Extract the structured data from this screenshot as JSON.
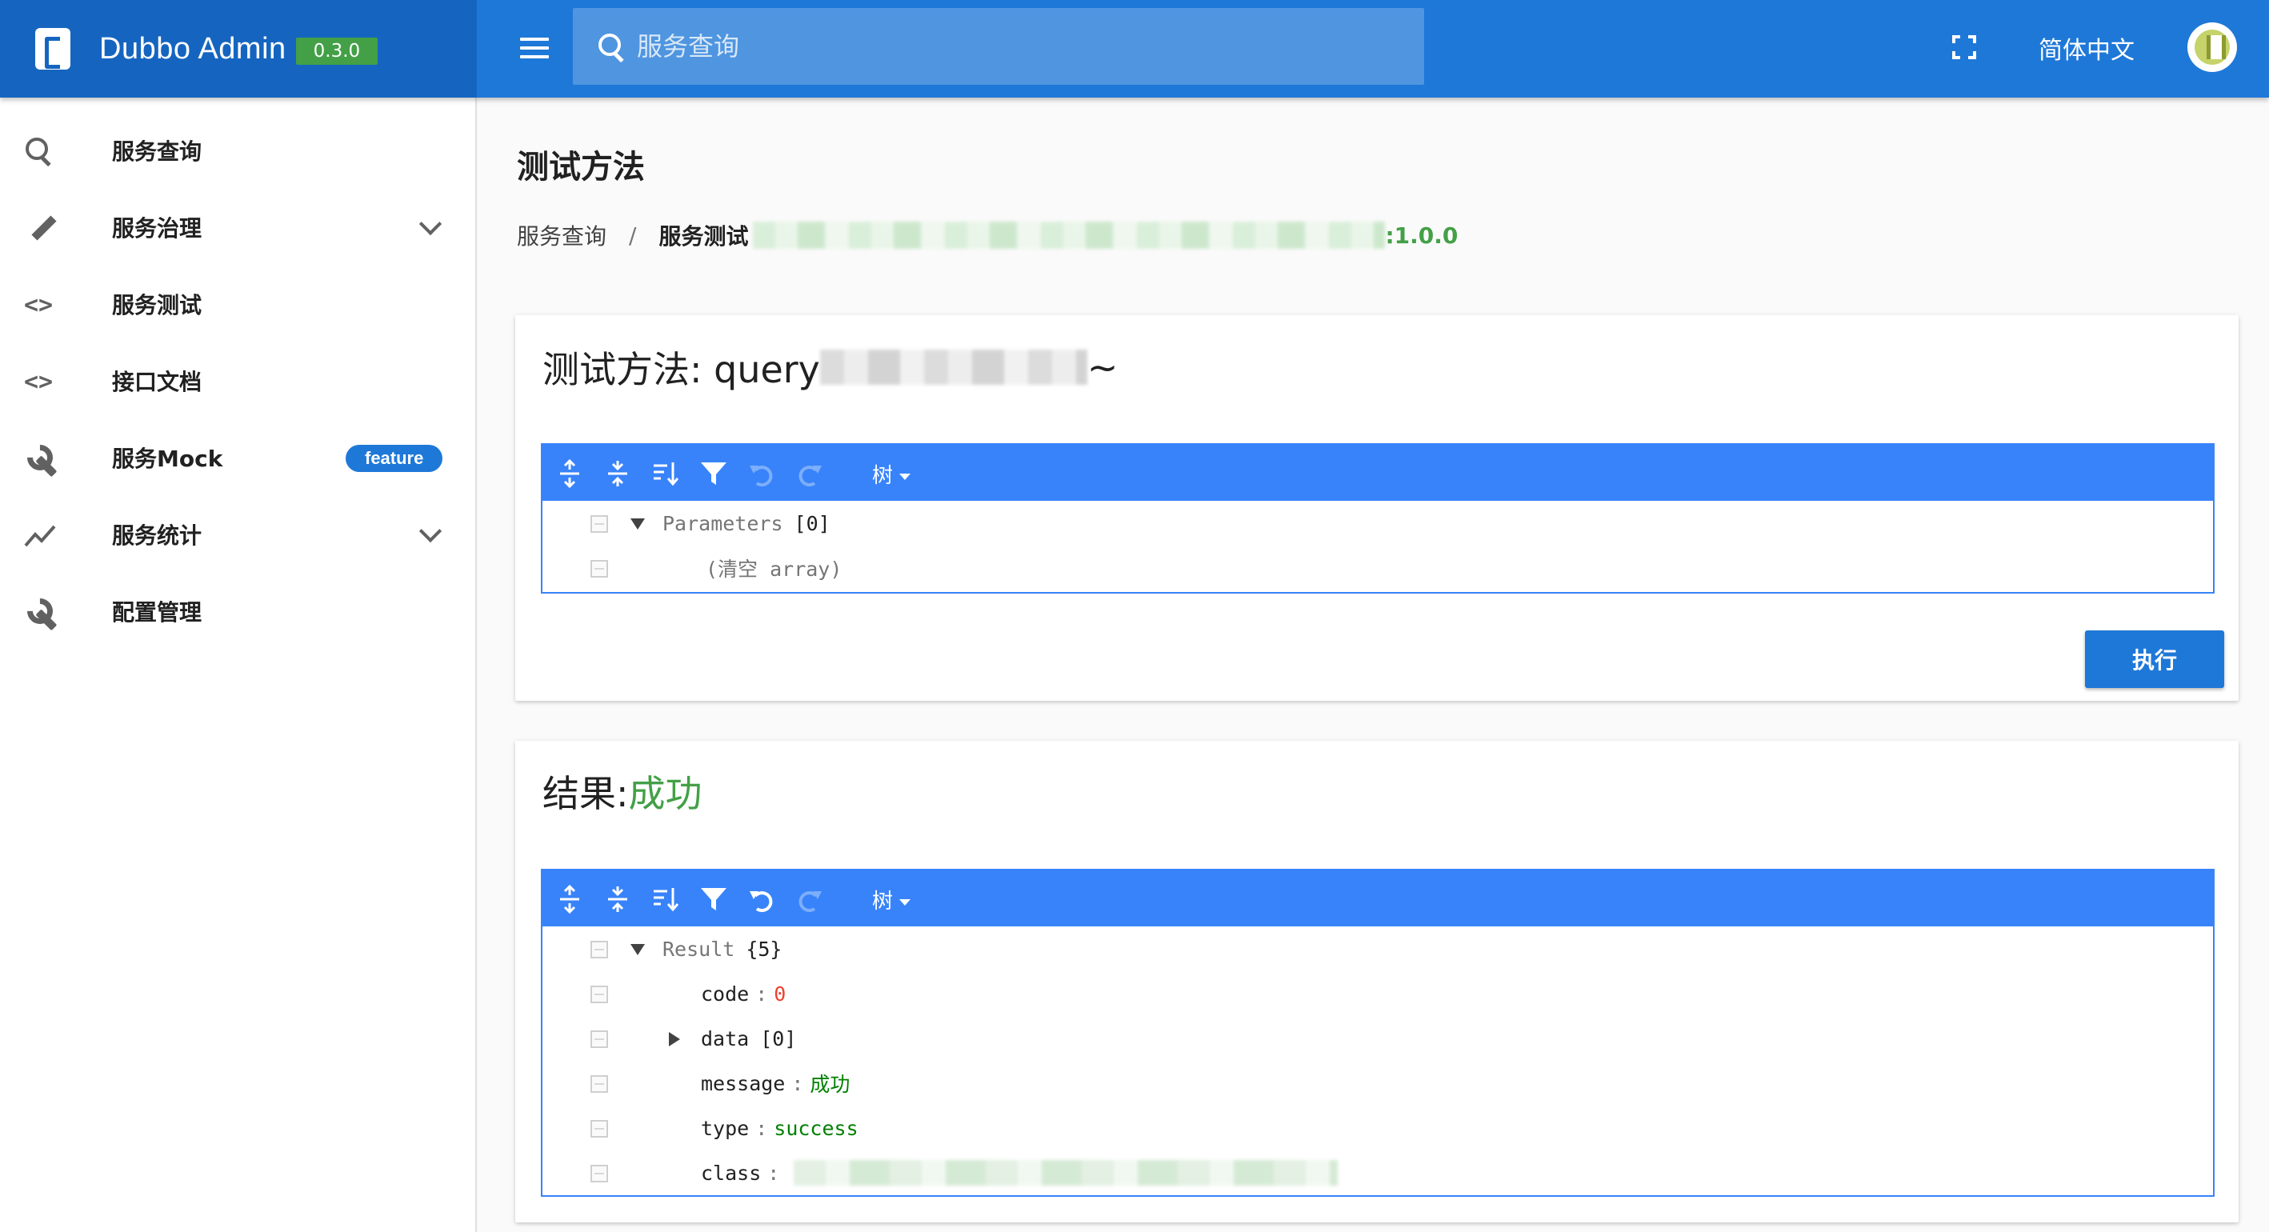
{
  "app": {
    "name": "Dubbo Admin",
    "version": "0.3.0"
  },
  "header": {
    "search_placeholder": "服务查询",
    "language": "简体中文"
  },
  "sidebar": {
    "items": [
      {
        "label": "服务查询",
        "icon": "search-icon"
      },
      {
        "label": "服务治理",
        "icon": "pencil-icon",
        "expandable": true
      },
      {
        "label": "服务测试",
        "icon": "code-icon"
      },
      {
        "label": "接口文档",
        "icon": "code-icon"
      },
      {
        "label": "服务Mock",
        "icon": "wrench-icon",
        "badge": "feature"
      },
      {
        "label": "服务统计",
        "icon": "trending-up-icon",
        "expandable": true
      },
      {
        "label": "配置管理",
        "icon": "wrench-icon"
      }
    ]
  },
  "page": {
    "title": "测试方法",
    "breadcrumb": {
      "root": "服务查询",
      "separator": "/",
      "current": "服务测试",
      "version": ":1.0.0"
    }
  },
  "method_card": {
    "title_prefix": "测试方法: query",
    "title_suffix": "~",
    "editor": {
      "mode": "树",
      "rows": [
        {
          "key": "Parameters",
          "count": "[0]"
        },
        {
          "text": "(清空 array)"
        }
      ]
    },
    "execute_label": "执行"
  },
  "result_card": {
    "title_prefix": "结果:",
    "status": "成功",
    "editor": {
      "mode": "树",
      "root": {
        "key": "Result",
        "count": "{5}"
      },
      "fields": [
        {
          "key": "code",
          "value": "0",
          "kind": "number"
        },
        {
          "key": "data",
          "count": "[0]",
          "collapsed": true
        },
        {
          "key": "message",
          "value": "成功",
          "kind": "string"
        },
        {
          "key": "type",
          "value": "success",
          "kind": "string"
        },
        {
          "key": "class",
          "value": "",
          "kind": "redacted"
        }
      ]
    }
  },
  "colors": {
    "primary": "#1e78d8",
    "brand_bg": "#1565c0",
    "success": "#43a047",
    "editor_blue": "#3883fa"
  }
}
